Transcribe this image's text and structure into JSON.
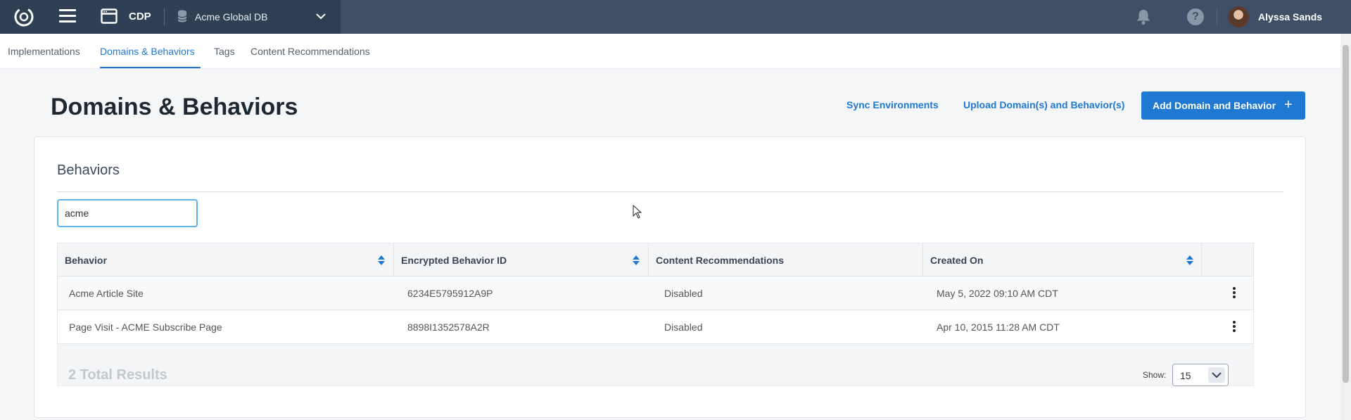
{
  "topbar": {
    "app_name": "CDP",
    "database": "Acme Global DB",
    "user_name": "Alyssa Sands",
    "help_symbol": "?"
  },
  "subnav": {
    "tabs": [
      {
        "label": "Implementations",
        "active": false
      },
      {
        "label": "Domains & Behaviors",
        "active": true
      },
      {
        "label": "Tags",
        "active": false
      },
      {
        "label": "Content Recommendations",
        "active": false
      }
    ]
  },
  "header": {
    "title": "Domains & Behaviors",
    "sync_label": "Sync Environments",
    "upload_label": "Upload Domain(s) and Behavior(s)",
    "add_label": "Add Domain and Behavior",
    "add_icon": "+"
  },
  "behaviors": {
    "title": "Behaviors",
    "search_value": "acme",
    "columns": [
      "Behavior",
      "Encrypted Behavior ID",
      "Content Recommendations",
      "Created On"
    ],
    "rows": [
      {
        "behavior": "Acme Article Site",
        "encrypted_id": "6234E5795912A9P",
        "content_recommendations": "Disabled",
        "created_on": "May 5, 2022 09:10 AM CDT"
      },
      {
        "behavior": "Page Visit - ACME Subscribe Page",
        "encrypted_id": "8898I1352578A2R",
        "content_recommendations": "Disabled",
        "created_on": "Apr 10, 2015 11:28 AM CDT"
      }
    ],
    "total_results": "2 Total Results",
    "show_label": "Show:",
    "show_value": "15"
  },
  "colors": {
    "topbar": "#3f5066",
    "accent": "#1f78d1"
  }
}
